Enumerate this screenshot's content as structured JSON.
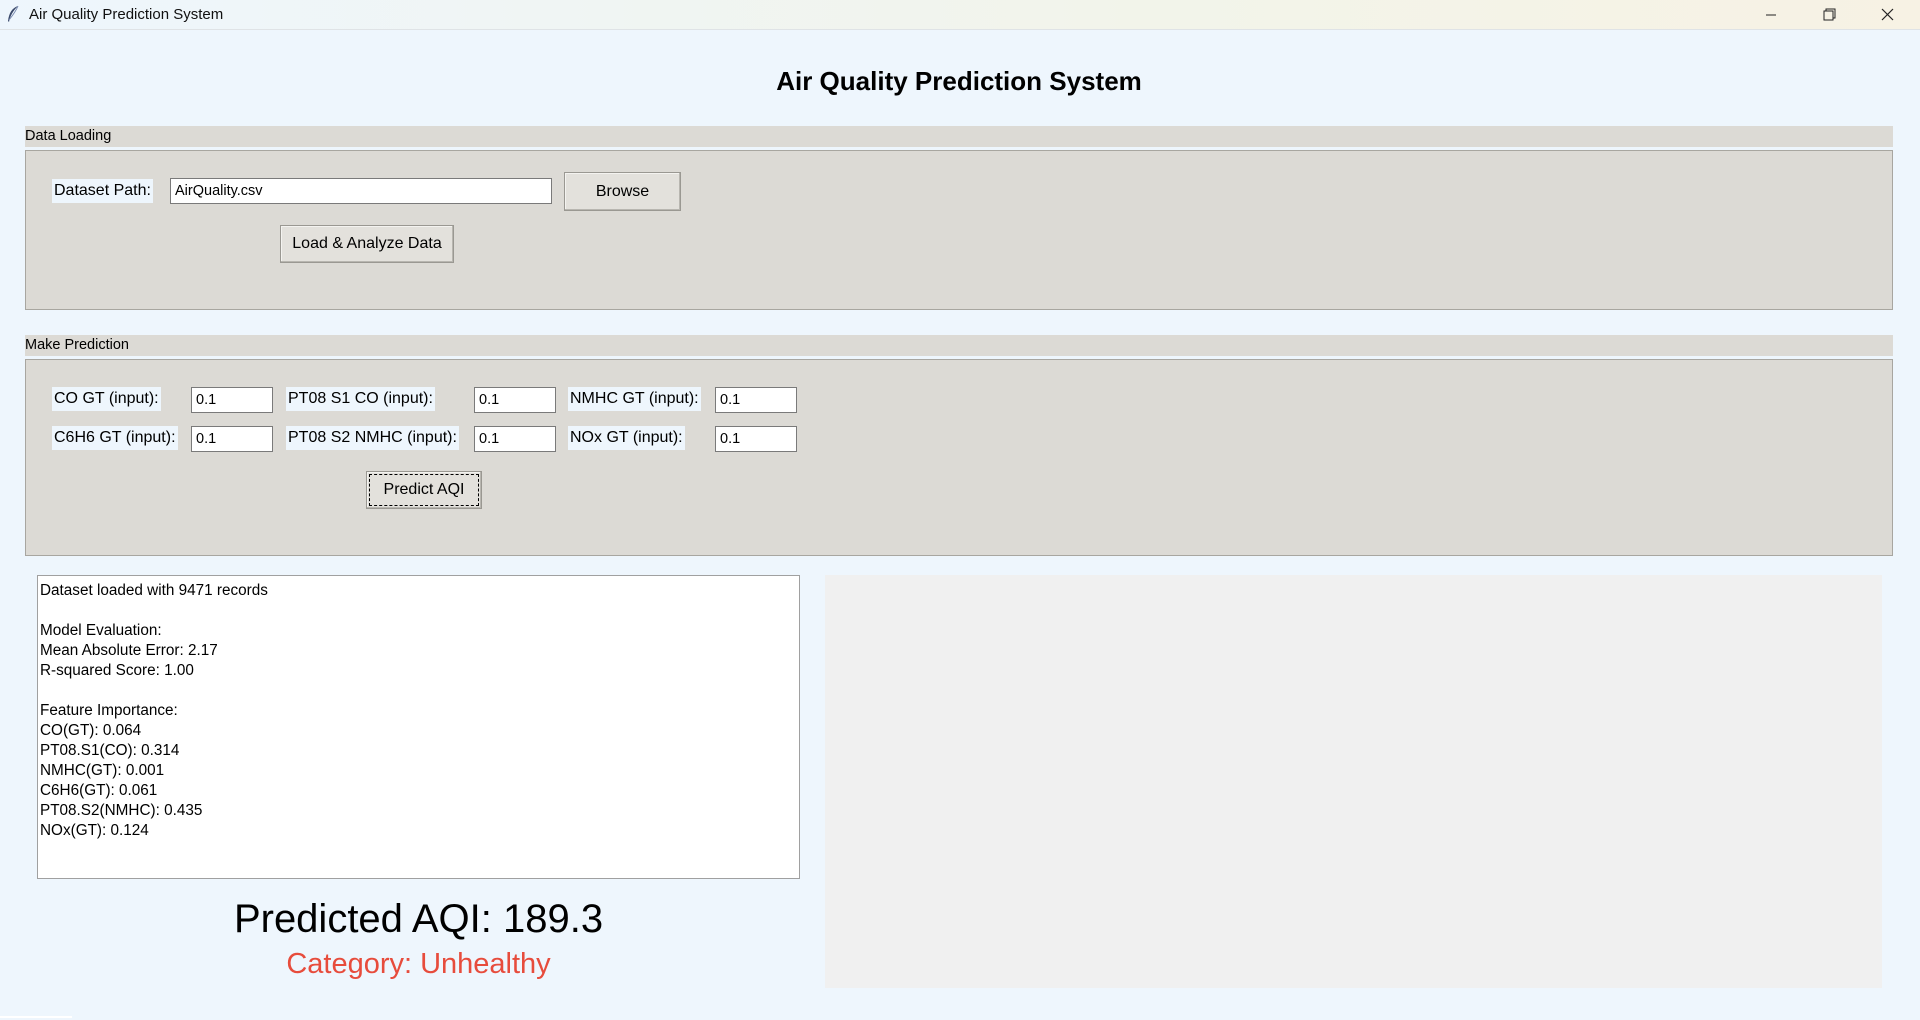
{
  "window": {
    "title": "Air Quality Prediction System"
  },
  "header": {
    "title": "Air Quality Prediction System"
  },
  "data_loading": {
    "section_label": "Data Loading",
    "dataset_path_label": "Dataset Path:",
    "dataset_path_value": "AirQuality.csv",
    "browse_label": "Browse",
    "load_label": "Load & Analyze Data"
  },
  "prediction": {
    "section_label": "Make Prediction",
    "fields": [
      {
        "label": "CO GT (input):",
        "value": "0.1"
      },
      {
        "label": "PT08 S1 CO (input):",
        "value": "0.1"
      },
      {
        "label": "NMHC GT (input):",
        "value": "0.1"
      },
      {
        "label": "C6H6 GT (input):",
        "value": "0.1"
      },
      {
        "label": "PT08 S2 NMHC (input):",
        "value": "0.1"
      },
      {
        "label": "NOx GT (input):",
        "value": "0.1"
      }
    ],
    "predict_label": "Predict AQI"
  },
  "log": {
    "lines": [
      "Dataset loaded with 9471 records",
      "",
      "Model Evaluation:",
      "Mean Absolute Error: 2.17",
      "R-squared Score: 1.00",
      "",
      "Feature Importance:",
      "CO(GT): 0.064",
      "PT08.S1(CO): 0.314",
      "NMHC(GT): 0.001",
      "C6H6(GT): 0.061",
      "PT08.S2(NMHC): 0.435",
      "NOx(GT): 0.124"
    ]
  },
  "result": {
    "aqi_text": "Predicted AQI: 189.3",
    "category_text": "Category: Unhealthy",
    "category_color": "#e74c3c"
  }
}
